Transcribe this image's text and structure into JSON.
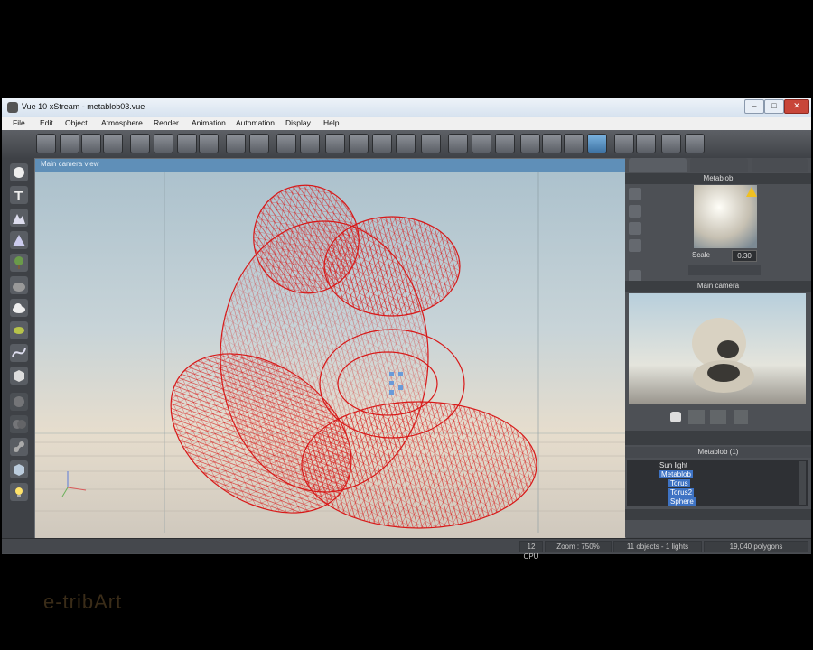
{
  "window": {
    "title": "Vue 10 xStream - metablob03.vue",
    "controls": [
      "–",
      "□",
      "✕"
    ]
  },
  "menubar": {
    "items": [
      "File",
      "Edit",
      "Object",
      "Atmosphere",
      "Render",
      "Animation",
      "Automation",
      "Display",
      "Help"
    ]
  },
  "toolbar": {
    "icons": [
      "new-file-icon",
      "open-file-icon",
      "save-icon",
      "save-as-icon",
      "cut-icon",
      "copy-icon",
      "paste-icon",
      "duplicate-icon",
      "undo-icon",
      "redo-icon",
      "render-icon",
      "render-area-icon",
      "atmosphere-icon",
      "cube-icon",
      "paint-icon",
      "sphere-icon",
      "color-icon",
      "terrain-icon",
      "bar-icon",
      "scale-icon",
      "zoom-in-icon",
      "zoom-out-icon",
      "zoom-reset-icon",
      "camera-view-icon",
      "film-icon",
      "clapper-icon",
      "frame-icon",
      "camera-icon"
    ]
  },
  "viewport": {
    "title": "Main camera view",
    "mesh_color": "#d81818"
  },
  "right_panel": {
    "object_title": "Metablob",
    "scale_label": "Scale",
    "scale_value": "0.30",
    "preview_title": "Main camera",
    "tree_title": "Metablob (1)",
    "tree": {
      "sun": "Sun light",
      "metablob": "Metablob",
      "children": [
        "Torus",
        "Torus2",
        "Sphere"
      ]
    }
  },
  "status": {
    "cpu": "12 CPU",
    "zoom": "Zoom : 750%",
    "objects": "11 objects - 1 lights",
    "polygons": "19,040 polygons"
  },
  "watermark": "e-tribArt"
}
